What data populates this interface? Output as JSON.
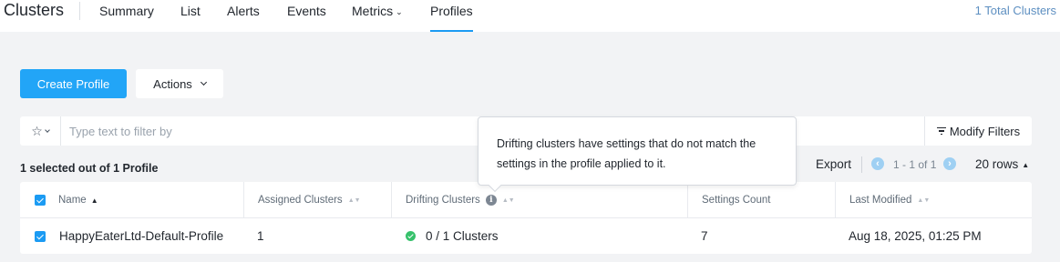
{
  "header": {
    "title": "Clusters",
    "tabs": [
      {
        "label": "Summary"
      },
      {
        "label": "List"
      },
      {
        "label": "Alerts"
      },
      {
        "label": "Events"
      },
      {
        "label": "Metrics"
      },
      {
        "label": "Profiles"
      }
    ],
    "active_tab": "Profiles",
    "total_clusters": "1 Total Clusters"
  },
  "toolbar": {
    "create_label": "Create Profile",
    "actions_label": "Actions"
  },
  "filter": {
    "placeholder": "Type text to filter by",
    "modify_label": "Modify Filters",
    "star_icon": "star-icon"
  },
  "status": {
    "selected_text": "1 selected out of 1 Profile",
    "export_label": "Export",
    "pagination_text": "1 - 1 of 1",
    "rows_label": "20 rows"
  },
  "table": {
    "columns": [
      {
        "label": "Name"
      },
      {
        "label": "Assigned Clusters"
      },
      {
        "label": "Drifting Clusters"
      },
      {
        "label": "Settings Count"
      },
      {
        "label": "Last Modified"
      }
    ],
    "rows": [
      {
        "name": "HappyEaterLtd-Default-Profile",
        "assigned": "1",
        "drifting": "0 / 1 Clusters",
        "settings_count": "7",
        "last_modified": "Aug 18, 2025, 01:25 PM",
        "selected": true
      }
    ]
  },
  "tooltip": {
    "text": "Drifting clusters have settings that do not match the settings in the profile applied to it."
  },
  "colors": {
    "primary": "#22a5f7",
    "active_tab_underline": "#1b9bf3",
    "status_ok": "#36c16b",
    "link": "#5d8fc1"
  }
}
